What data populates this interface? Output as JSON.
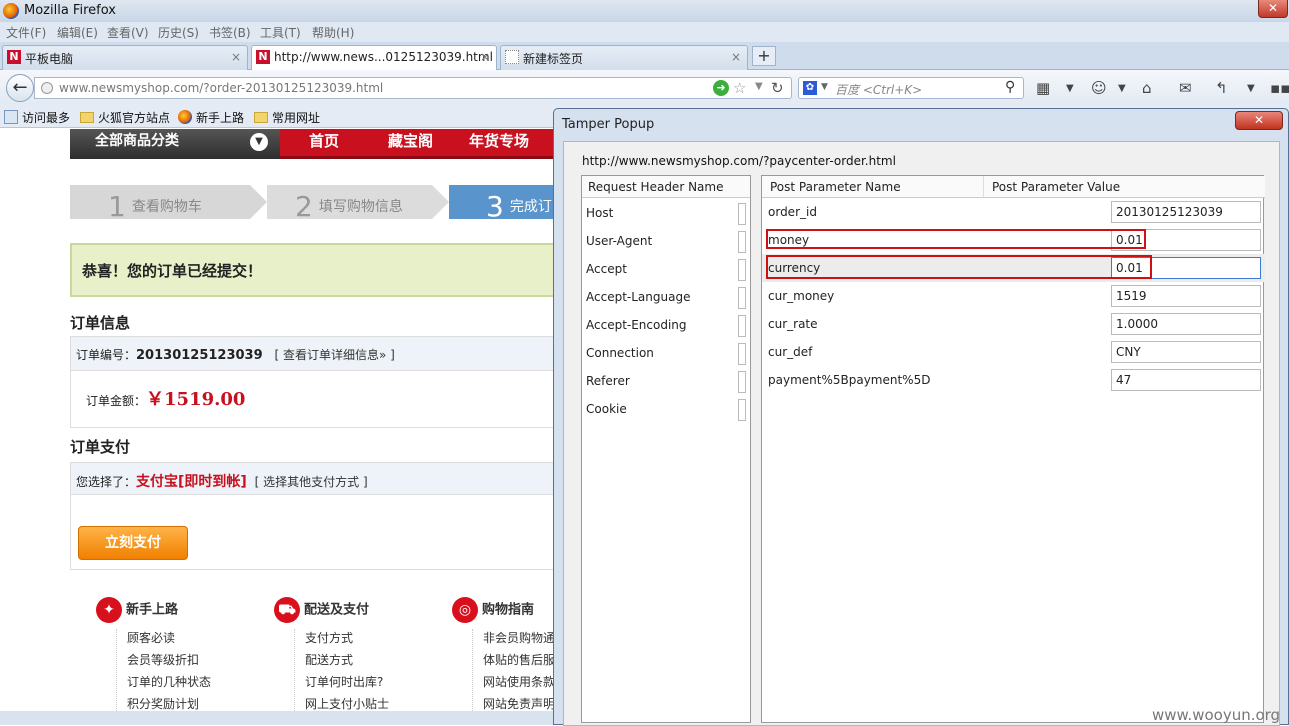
{
  "window": {
    "title": "Mozilla Firefox",
    "close": "✕"
  },
  "menu": [
    "文件(F)",
    "编辑(E)",
    "查看(V)",
    "历史(S)",
    "书签(B)",
    "工具(T)",
    "帮助(H)"
  ],
  "tabs": [
    {
      "label": "平板电脑",
      "icon": "N"
    },
    {
      "label": "http://www.news...0125123039.html",
      "icon": "N"
    },
    {
      "label": "新建标签页",
      "icon": ""
    }
  ],
  "new_tab": "+",
  "address": {
    "url": "www.newsmyshop.com/?order-20130125123039.html"
  },
  "search": {
    "placeholder": "百度 <Ctrl+K>"
  },
  "bookmarks": [
    "访问最多",
    "火狐官方站点",
    "新手上路",
    "常用网址"
  ],
  "page": {
    "category": "全部商品分类",
    "nav": [
      "首页",
      "藏宝阁",
      "年货专场"
    ],
    "steps": [
      {
        "num": "1",
        "label": "查看购物车"
      },
      {
        "num": "2",
        "label": "填写购物信息"
      },
      {
        "num": "3",
        "label": "完成订"
      }
    ],
    "congrats": "恭喜！您的订单已经提交！",
    "order_info_title": "订单信息",
    "order_no_label": "订单编号：",
    "order_no": "20130125123039",
    "order_detail_link": "[ 查看订单详细信息» ]",
    "amount_label": "订单金额：",
    "amount": "￥1519.00",
    "pay_title": "订单支付",
    "pay_selected_label": "您选择了：",
    "pay_method": "支付宝[即时到帐]",
    "pay_other_link": "[ 选择其他支付方式 ]",
    "pay_button": "立刻支付",
    "footer": [
      {
        "title": "新手上路",
        "links": [
          "顾客必读",
          "会员等级折扣",
          "订单的几种状态",
          "积分奖励计划"
        ]
      },
      {
        "title": "配送及支付",
        "links": [
          "支付方式",
          "配送方式",
          "订单何时出库?",
          "网上支付小贴士"
        ]
      },
      {
        "title": "购物指南",
        "links": [
          "非会员购物通",
          "体贴的售后服",
          "网站使用条款",
          "网站免责声明"
        ]
      }
    ]
  },
  "tamper": {
    "title": "Tamper Popup",
    "close": "✕",
    "url": "http://www.newsmyshop.com/?paycenter-order.html",
    "header_col": "Request Header Name",
    "headers": [
      "Host",
      "User-Agent",
      "Accept",
      "Accept-Language",
      "Accept-Encoding",
      "Connection",
      "Referer",
      "Cookie"
    ],
    "param_name_col": "Post Parameter Name",
    "param_value_col": "Post Parameter Value",
    "params": [
      {
        "name": "order_id",
        "value": "20130125123039"
      },
      {
        "name": "money",
        "value": "0.01"
      },
      {
        "name": "currency",
        "value": "0.01"
      },
      {
        "name": "cur_money",
        "value": "1519"
      },
      {
        "name": "cur_rate",
        "value": "1.0000"
      },
      {
        "name": "cur_def",
        "value": "CNY"
      },
      {
        "name": "payment%5Bpayment%5D",
        "value": "47"
      }
    ]
  },
  "watermark": "www.wooyun.org"
}
